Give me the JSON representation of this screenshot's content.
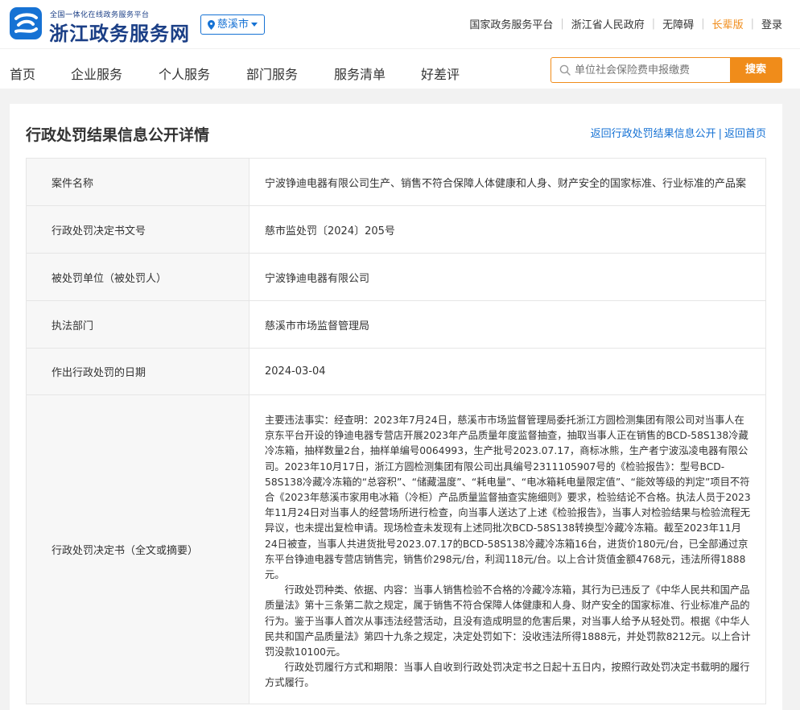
{
  "header": {
    "logo_small": "全国一体化在线政务服务平台",
    "logo_big": "浙江政务服务网",
    "city": "慈溪市",
    "links": [
      "国家政务服务平台",
      "浙江省人民政府",
      "无障碍",
      "长辈版",
      "登录"
    ]
  },
  "nav": {
    "items": [
      "首页",
      "企业服务",
      "个人服务",
      "部门服务",
      "服务清单",
      "好差评"
    ],
    "search_placeholder": "单位社会保险费申报缴费",
    "search_button": "搜索"
  },
  "detail": {
    "title": "行政处罚结果信息公开详情",
    "back_link_1": "返回行政处罚结果信息公开",
    "back_link_2": "返回首页",
    "link_separator": "|",
    "rows": [
      {
        "label": "案件名称",
        "value": "宁波铮迪电器有限公司生产、销售不符合保障人体健康和人身、财产安全的国家标准、行业标准的产品案"
      },
      {
        "label": "行政处罚决定书文号",
        "value": "慈市监处罚〔2024〕205号"
      },
      {
        "label": "被处罚单位（被处罚人）",
        "value": "宁波铮迪电器有限公司"
      },
      {
        "label": "执法部门",
        "value": "慈溪市市场监督管理局"
      },
      {
        "label": "作出行政处罚的日期",
        "value": "2024-03-04"
      },
      {
        "label": "行政处罚决定书（全文或摘要）",
        "paragraphs": [
          "主要违法事实：经查明：2023年7月24日，慈溪市市场监督管理局委托浙江方圆检测集团有限公司对当事人在京东平台开设的铮迪电器专营店开展2023年产品质量年度监督抽查，抽取当事人正在销售的BCD-58S138冷藏冷冻箱，抽样数量2台，抽样单编号0064993，生产批号2023.07.17，商标冰熊，生产者宁波泓凌电器有限公司。2023年10月17日，浙江方圆检测集团有限公司出具编号2311105907号的《检验报告》：型号BCD-58S138冷藏冷冻箱的“总容积”、“储藏温度”、“耗电量”、“电冰箱耗电量限定值”、“能效等级的判定”项目不符合《2023年慈溪市家用电冰箱（冷柜）产品质量监督抽查实施细则》要求，检验结论不合格。执法人员于2023年11月24日对当事人的经营场所进行检查，向当事人送达了上述《检验报告》，当事人对检验结果与检验流程无异议，也未提出复检申请。现场检查未发现有上述同批次BCD-58S138转换型冷藏冷冻箱。截至2023年11月24日被查，当事人共进货批号2023.07.17的BCD-58S138冷藏冷冻箱16台，进货价180元/台，已全部通过京东平台铮迪电器专营店销售完，销售价298元/台，利润118元/台。以上合计货值金额4768元，违法所得1888元。",
          "　　行政处罚种类、依据、内容：当事人销售检验不合格的冷藏冷冻箱，其行为已违反了《中华人民共和国产品质量法》第十三条第二款之规定，属于销售不符合保障人体健康和人身、财产安全的国家标准、行业标准产品的行为。鉴于当事人首次从事违法经营活动，且没有造成明显的危害后果，对当事人给予从轻处罚。根据《中华人民共和国产品质量法》第四十九条之规定，决定处罚如下：没收违法所得1888元，并处罚款8212元。以上合计罚没款10100元。",
          "　　行政处罚履行方式和期限：当事人自收到行政处罚决定书之日起十五日内，按照行政处罚决定书载明的履行方式履行。"
        ]
      }
    ]
  },
  "colors": {
    "brand_blue": "#1672d4",
    "accent_orange": "#f08c1a",
    "logo_text": "#1b3f86"
  },
  "icons": [
    "zhejiang-logo-icon",
    "location-pin-icon",
    "chevron-down-icon",
    "search-icon"
  ]
}
